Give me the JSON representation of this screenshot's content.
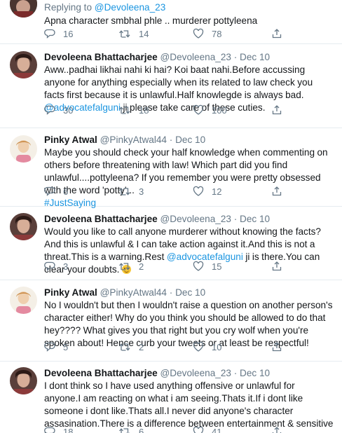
{
  "replying": {
    "prefix": "Replying to",
    "handle": "@Devoleena_23"
  },
  "top_tweet": {
    "text": "Apna character smbhal phle .. murderer pottyleena",
    "stats": {
      "replies": "16",
      "retweets": "14",
      "likes": "78"
    }
  },
  "tweets": [
    {
      "name": "Devoleena Bhattacharjee",
      "handle": "@Devoleena_23",
      "date": "Dec 10",
      "text_a": "Aww..padhai likhai nahi ki hai? Koi baat nahi.Before accussing anyone for anything especially when its related to law check you facts first because it is unlawful.Half knowlegde is always bad. ",
      "mention": "@advocatefalguni",
      "text_b": " ji please take care of these cuties.",
      "stats": {
        "replies": "30",
        "retweets": "18",
        "likes": "100"
      }
    },
    {
      "name": "Pinky Atwal",
      "handle": "@PinkyAtwal44",
      "date": "Dec 10",
      "text_a": "Maybe you should check your half knowledge when commenting on others before threatening with law! Which part did you find unlawful....pottyleena? If you remember you were pretty obsessed with the word 'potty'...",
      "hashtag": "#JustSaying",
      "stats": {
        "replies": "6",
        "retweets": "3",
        "likes": "12"
      }
    },
    {
      "name": "Devoleena Bhattacharjee",
      "handle": "@Devoleena_23",
      "date": "Dec 10",
      "text_a": "Would you like to call anyone murderer without knowing the facts? And this is unlawful & I can take action against it.And this is not a threat.This is a warning.Rest ",
      "mention": "@advocatefalguni",
      "text_b": " ji is there.You can clear your doubts. ",
      "stats": {
        "replies": "3",
        "retweets": "2",
        "likes": "15"
      }
    },
    {
      "name": "Pinky Atwal",
      "handle": "@PinkyAtwal44",
      "date": "Dec 10",
      "text_a": "No I wouldn't but then I wouldn't raise a question on another person's character either! Why do you think you should be allowed to do that hey???? What gives you that right but you cry wolf when you're spoken about! Hence curb your tweets or at least be respectful!",
      "stats": {
        "replies": "5",
        "retweets": "2",
        "likes": "10"
      }
    },
    {
      "name": "Devoleena Bhattacharjee",
      "handle": "@Devoleena_23",
      "date": "Dec 10",
      "text_a": "I dont think so I have used anything offensive or unlawful for anyone.I am reacting on what i am seeing.Thats it.If i dont like someone i dont like.Thats all.I never did anyone's character assasination.There is a difference between entertainment & sensitive issues",
      "stats": {
        "replies": "18",
        "retweets": "6",
        "likes": "41"
      }
    }
  ],
  "separator": "·",
  "colors": {
    "link": "#1b95e0",
    "meta": "#657786",
    "divider": "#e6ecf0"
  }
}
